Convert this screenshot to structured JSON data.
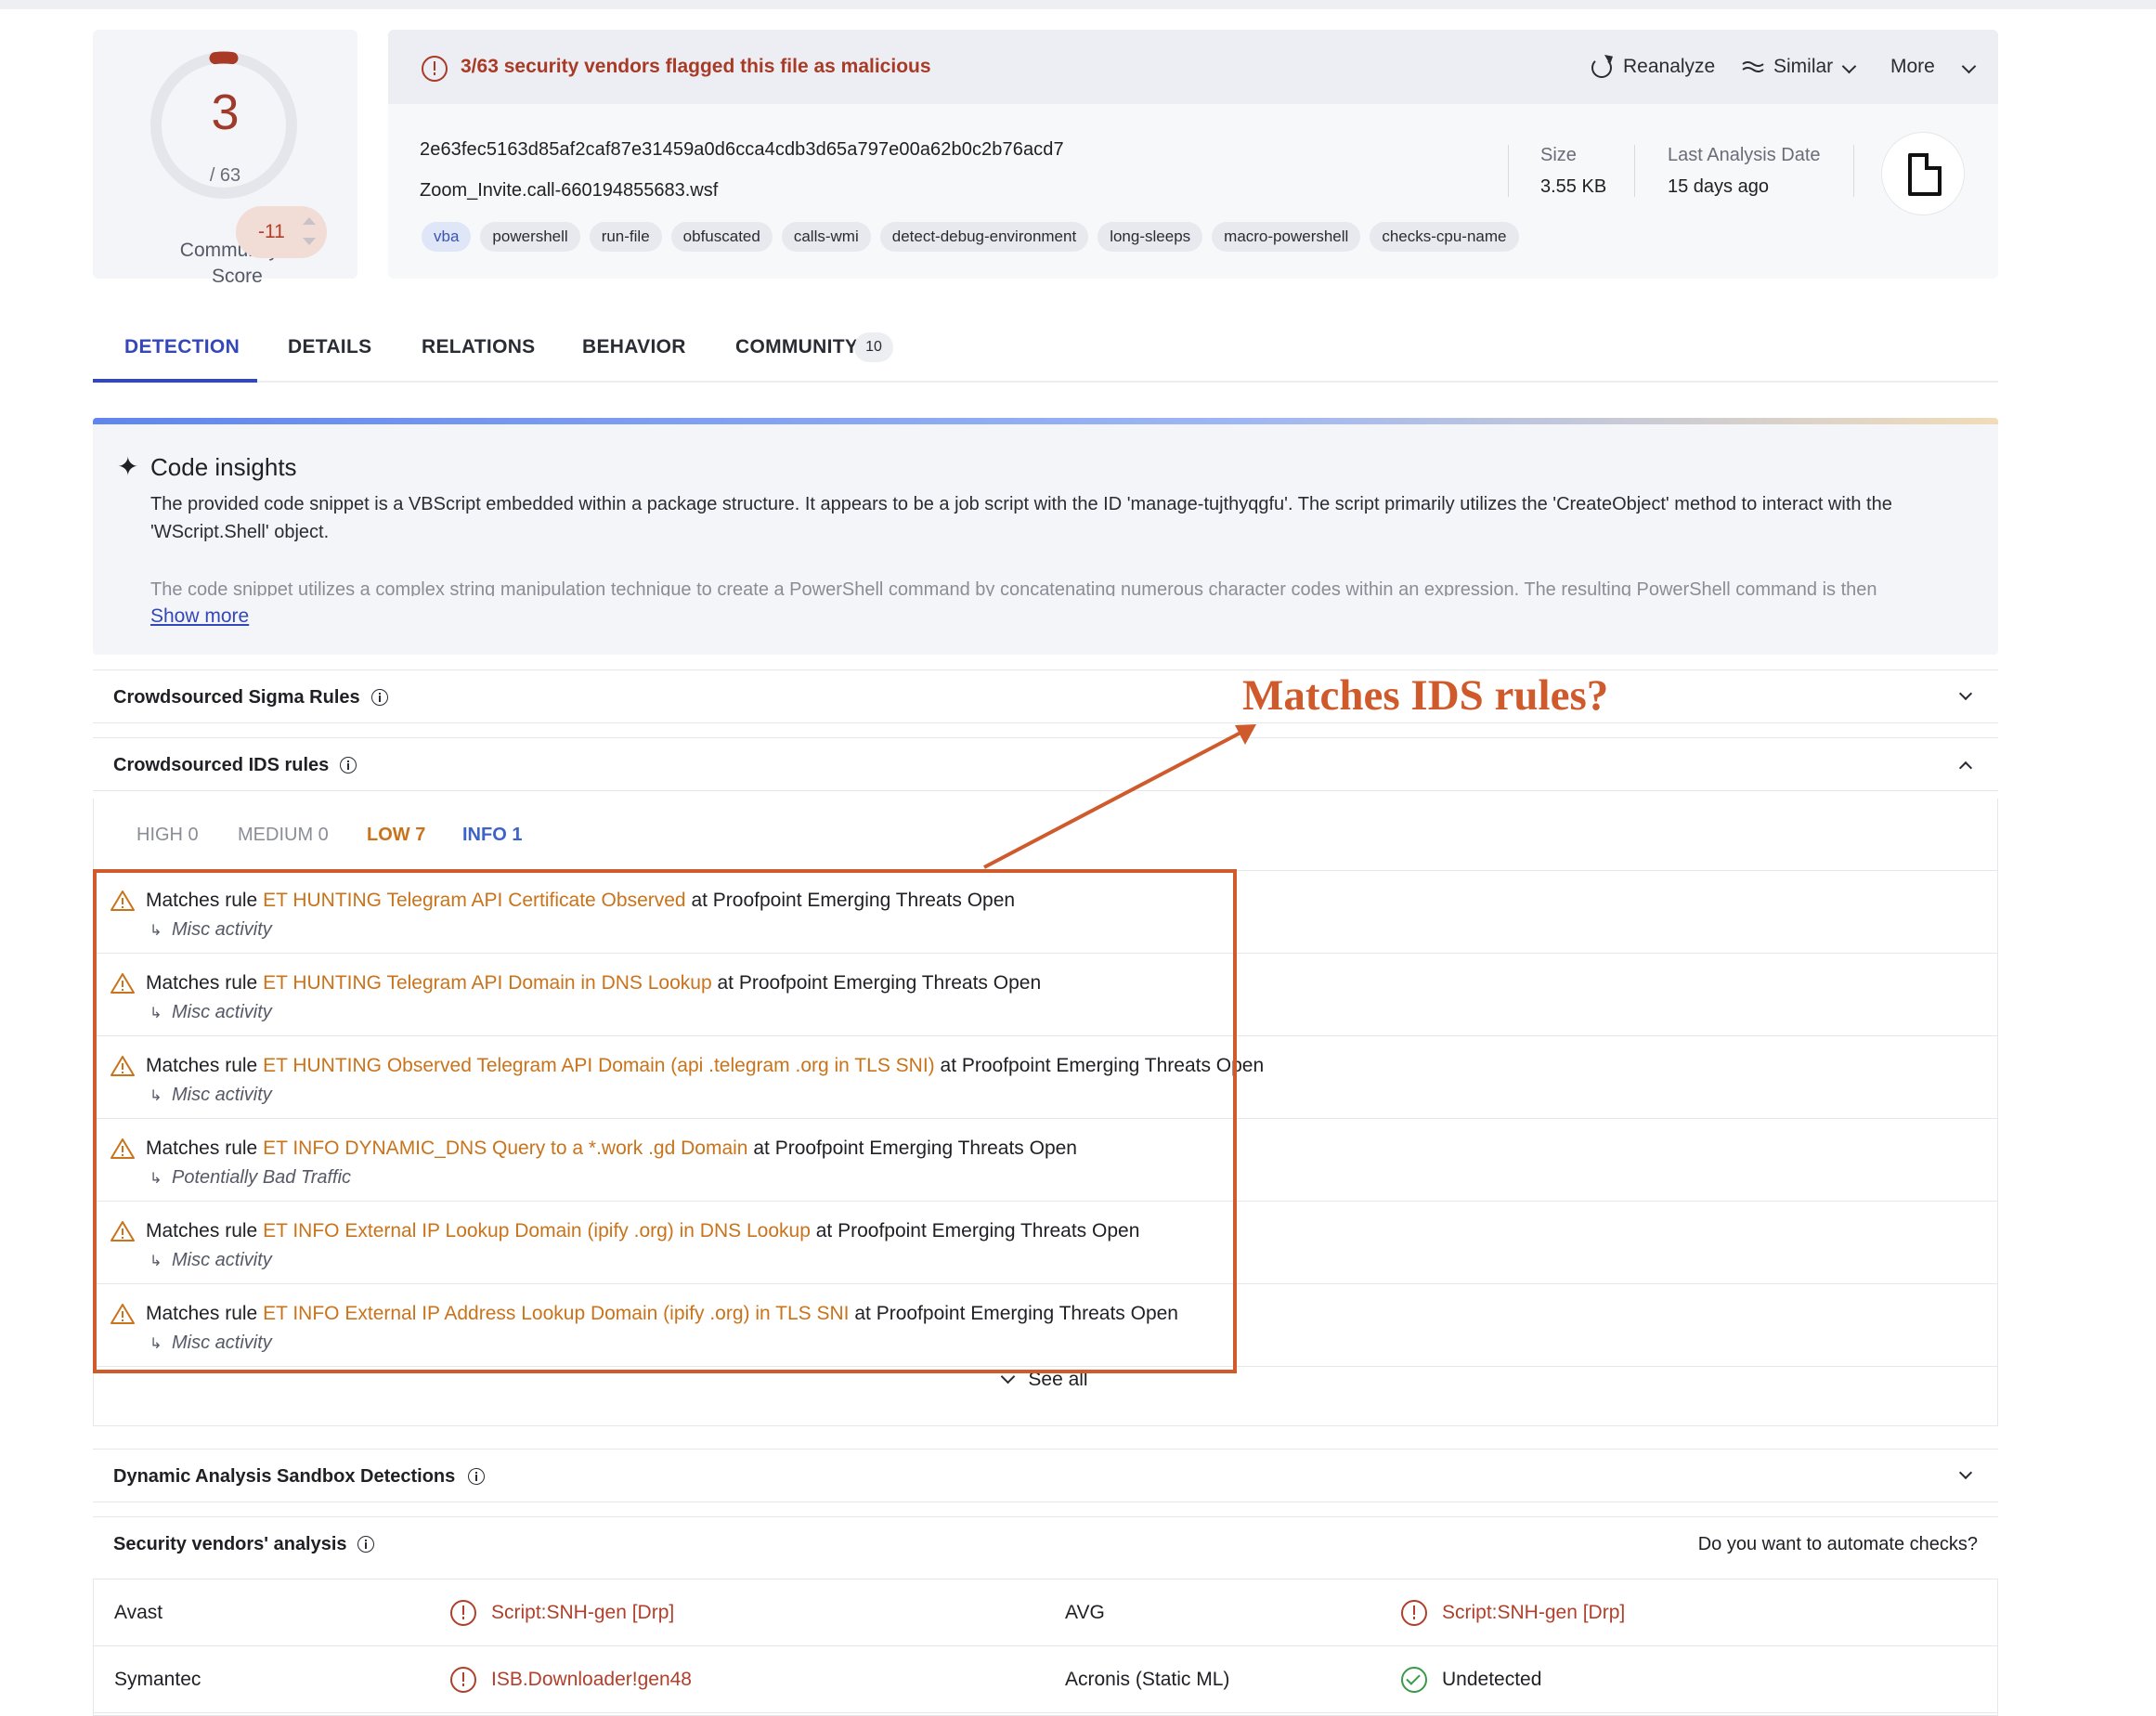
{
  "score": {
    "detections": "3",
    "total": "/ 63",
    "community_label_line1": "Community",
    "community_label_line2": "Score",
    "community_score": "-11"
  },
  "header": {
    "alert": "3/63 security vendors flagged this file as malicious",
    "reanalyze": "Reanalyze",
    "similar": "Similar",
    "more": "More",
    "hash": "2e63fec5163d85af2caf87e31459a0d6cca4cdb3d65a797e00a62b0c2b76acd7",
    "filename": "Zoom_Invite.call-660194855683.wsf",
    "tags": [
      "vba",
      "powershell",
      "run-file",
      "obfuscated",
      "calls-wmi",
      "detect-debug-environment",
      "long-sleeps",
      "macro-powershell",
      "checks-cpu-name"
    ],
    "size_label": "Size",
    "size_value": "3.55 KB",
    "date_label": "Last Analysis Date",
    "date_value": "15 days ago"
  },
  "tabs": {
    "detection": "DETECTION",
    "details": "DETAILS",
    "relations": "RELATIONS",
    "behavior": "BEHAVIOR",
    "community": "COMMUNITY",
    "community_count": "10"
  },
  "insights": {
    "title": "Code insights",
    "p1": "The provided code snippet is a VBScript embedded within a package structure. It appears to be a job script with the ID 'manage-tujthyqgfu'. The script primarily utilizes the 'CreateObject' method to interact with the 'WScript.Shell' object.",
    "p2": "The code snippet utilizes a complex string manipulation technique to create a PowerShell command by concatenating numerous character codes within an expression. The resulting PowerShell command is then",
    "show_more": "Show more"
  },
  "sections": {
    "sigma": "Crowdsourced Sigma Rules",
    "ids": "Crowdsourced IDS rules",
    "sandbox": "Dynamic Analysis Sandbox Detections",
    "vendors": "Security vendors' analysis",
    "automate": "Do you want to automate checks?"
  },
  "ids": {
    "severity": {
      "high": "HIGH 0",
      "medium": "MEDIUM 0",
      "low": "LOW 7",
      "info": "INFO 1"
    },
    "prefix": "Matches rule",
    "rules": [
      {
        "name": "ET HUNTING Telegram API Certificate Observed",
        "source": "at Proofpoint Emerging Threats Open",
        "category": "Misc activity"
      },
      {
        "name": "ET HUNTING Telegram API Domain in DNS Lookup",
        "source": "at Proofpoint Emerging Threats Open",
        "category": "Misc activity"
      },
      {
        "name": "ET HUNTING Observed Telegram API Domain (api .telegram .org in TLS SNI)",
        "source": "at Proofpoint Emerging Threats Open",
        "category": "Misc activity"
      },
      {
        "name": "ET INFO DYNAMIC_DNS Query to a *.work .gd Domain",
        "source": "at Proofpoint Emerging Threats Open",
        "category": "Potentially Bad Traffic"
      },
      {
        "name": "ET INFO External IP Lookup Domain (ipify .org) in DNS Lookup",
        "source": "at Proofpoint Emerging Threats Open",
        "category": "Misc activity"
      },
      {
        "name": "ET INFO External IP Address Lookup Domain (ipify .org) in TLS SNI",
        "source": "at Proofpoint Emerging Threats Open",
        "category": "Misc activity"
      }
    ],
    "see_all": "See all"
  },
  "annotation": {
    "text": "Matches IDS rules?",
    "color": "#cf5b2c"
  },
  "vendors": [
    {
      "left_name": "Avast",
      "left_result": "Script:SNH-gen [Drp]",
      "right_name": "AVG",
      "right_result": "Script:SNH-gen [Drp]"
    },
    {
      "left_name": "Symantec",
      "left_result": "ISB.Downloader!gen48",
      "right_name": "Acronis (Static ML)",
      "right_result": "Undetected"
    }
  ]
}
